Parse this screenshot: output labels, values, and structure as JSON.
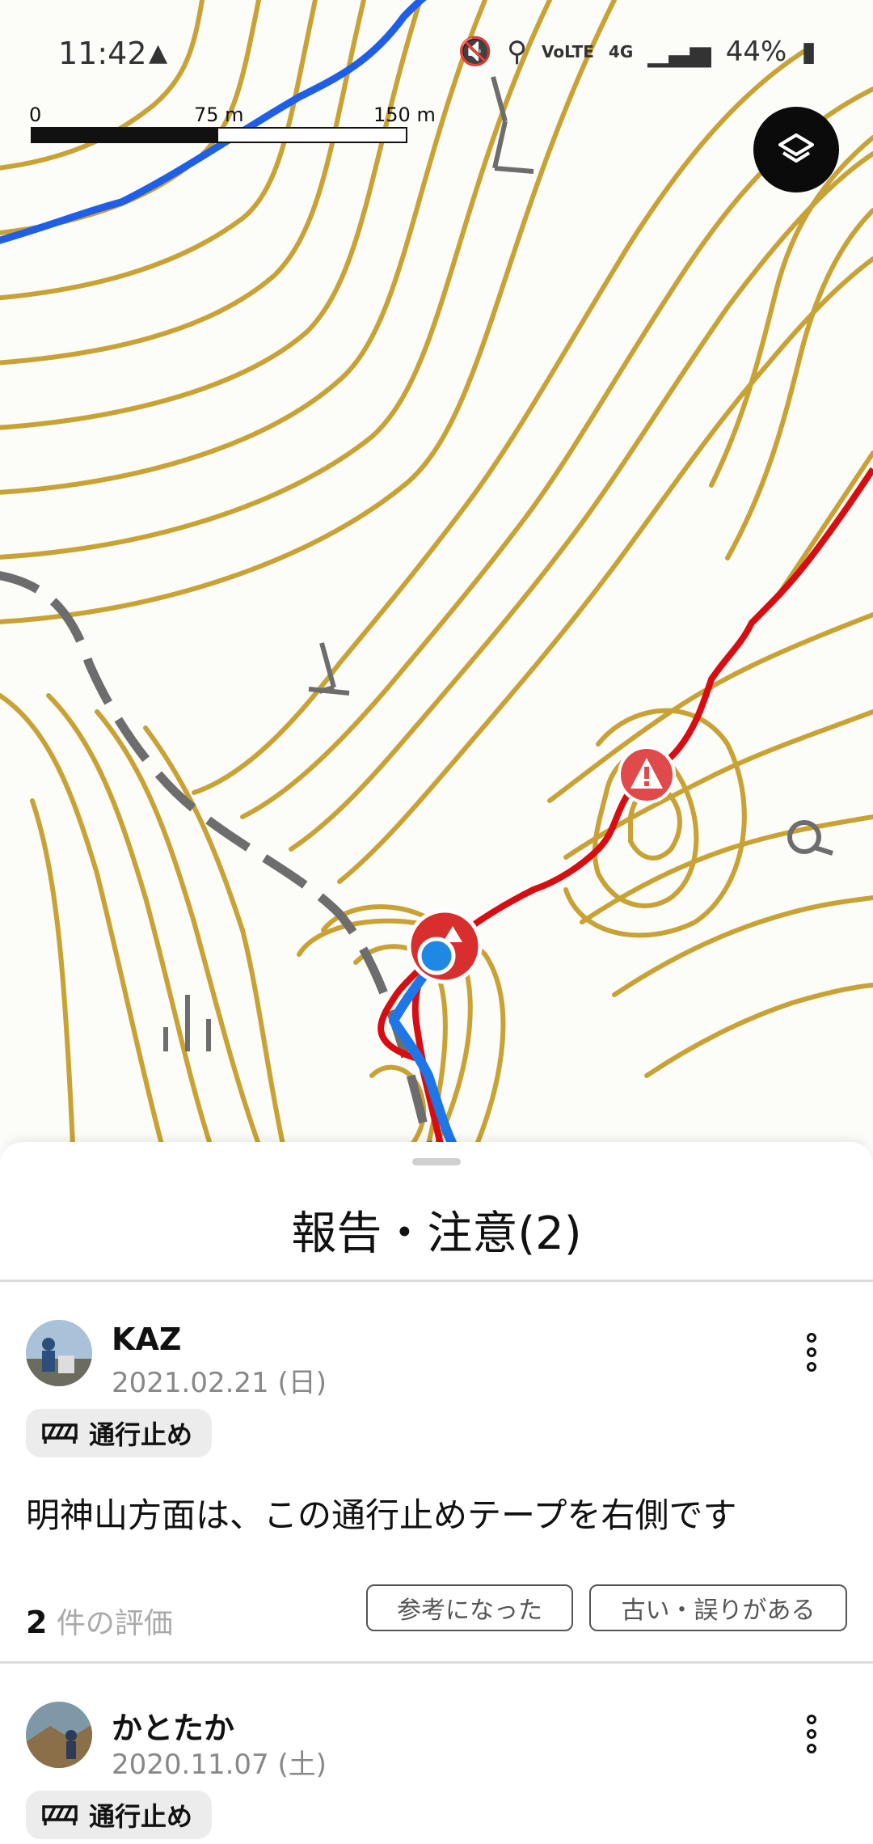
{
  "status_bar": {
    "time": "11:42",
    "network": "4G",
    "volte": "VoLTE",
    "battery": "44%",
    "icons": [
      "warning-triangle-icon",
      "mute-icon",
      "location-icon",
      "volte-icon",
      "network-4g-icon",
      "signal-icon",
      "battery-icon"
    ]
  },
  "map": {
    "scale_labels": [
      "0",
      "75 m",
      "150 m"
    ],
    "layers_icon": "layers-icon",
    "warning_icon": "warning-icon",
    "colors": {
      "contour": "#c9a235",
      "trail": "#d80d12",
      "track_blue": "#1f76e6",
      "road_blue": "#1f5fe8",
      "dashed_road": "#6d6d6d",
      "water": "#86c4ec"
    }
  },
  "sheet": {
    "title": "報告・注意(2)",
    "reports": [
      {
        "user": "KAZ",
        "date": "2021.02.21 (日)",
        "tag": "通行止め",
        "tag_icon": "barrier-icon",
        "comment": "明神山方面は、この通行止めテープを右側です",
        "rating_count": "2",
        "rating_label": "件の評価",
        "helpful_label": "参考になった",
        "outdated_label": "古い・誤りがある"
      },
      {
        "user": "かとたか",
        "date": "2020.11.07 (土)",
        "tag": "通行止め",
        "tag_icon": "barrier-icon"
      }
    ]
  }
}
